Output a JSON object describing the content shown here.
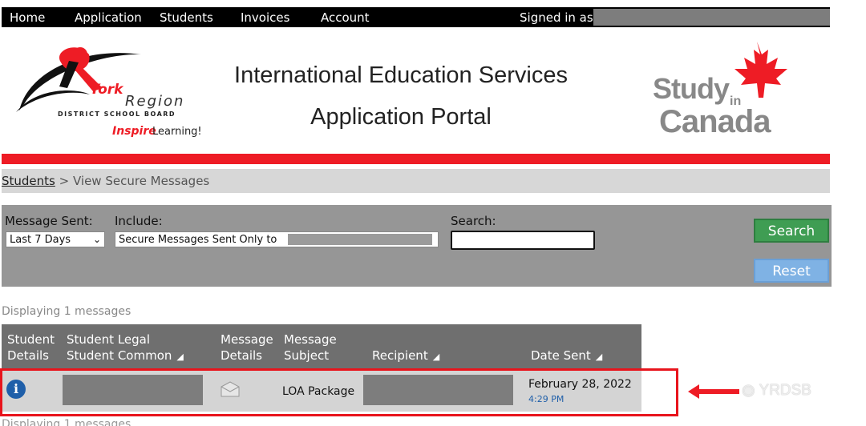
{
  "nav": {
    "items": [
      "Home",
      "Application",
      "Students",
      "Invoices",
      "Account"
    ],
    "signed_in_label": "Signed in as"
  },
  "header": {
    "title_line1": "International Education Services",
    "title_line2": "Application Portal",
    "board_logo": {
      "york": "York",
      "region": "Region",
      "board": "DISTRICT SCHOOL BOARD",
      "inspire": "Inspire",
      "learning": "Learning!"
    },
    "study_logo": {
      "study": "Study",
      "in": "in",
      "canada": "Canada"
    }
  },
  "breadcrumb": {
    "link": "Students",
    "separator": " > ",
    "current": "View Secure Messages"
  },
  "filters": {
    "message_sent_label": "Message Sent:",
    "message_sent_value": "Last 7 Days",
    "include_label": "Include:",
    "include_value": "Secure Messages Sent Only to",
    "search_label": "Search:",
    "search_value": "",
    "search_button": "Search",
    "reset_button": "Reset"
  },
  "count_text": "Displaying 1 messages",
  "table": {
    "headers": {
      "student_details": [
        "Student",
        "Details"
      ],
      "student_name": [
        "Student Legal",
        "Student Common"
      ],
      "message_details": [
        "Message",
        "Details"
      ],
      "message_subject": [
        "Message",
        "Subject"
      ],
      "recipient": "Recipient",
      "date_sent": "Date Sent"
    },
    "rows": [
      {
        "subject": "LOA Package",
        "date": "February 28, 2022",
        "time": "4:29 PM"
      }
    ]
  },
  "watermark": "YRDSB",
  "colors": {
    "accent_red": "#ee1c25",
    "search_green": "#3f9d53",
    "reset_blue": "#7fb2e4",
    "link_blue": "#1f5fa9"
  }
}
